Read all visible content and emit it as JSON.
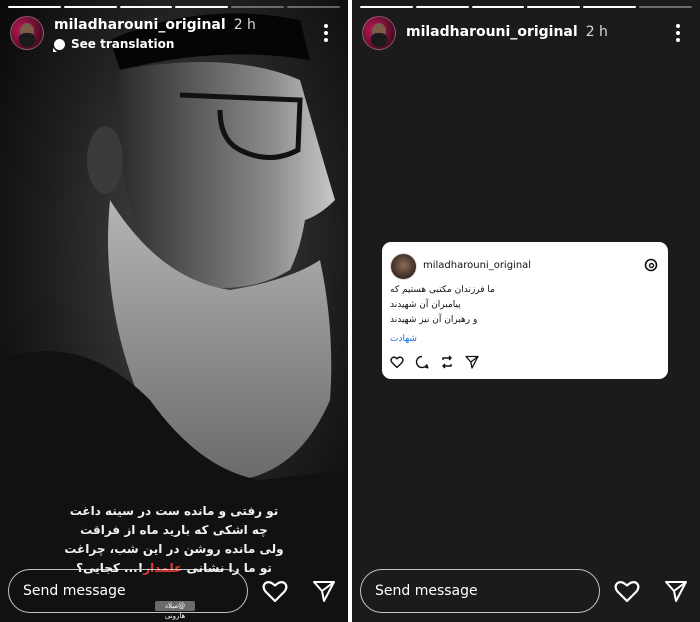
{
  "left_story": {
    "username": "miladharouni_original",
    "time": "2 h",
    "translation_label": "See translation",
    "poem_lines": [
      "تو رفتی و مانده ست در سینه داغت",
      "چه اشکی که بارید ماه از فراقت",
      "ولی مانده روشن در این شب، چراغت"
    ],
    "poem_last_before": "تو ما را نشانی",
    "poem_highlight": "علمدار",
    "poem_last_after": "!... کجایی؟",
    "watermark": "@میلاد هارونی",
    "send_placeholder": "Send message"
  },
  "right_story": {
    "username": "miladharouni_original",
    "time": "2 h",
    "card": {
      "username": "miladharouni_original",
      "lines": [
        "ما فرزندان مکتبی هستیم که",
        "پیامبران آن شهیدند",
        "و رهبران آن نیز شهیدند"
      ],
      "hashtag": "شهادت"
    },
    "send_placeholder": "Send message"
  },
  "colors": {
    "highlight_red": "#e53935",
    "link_blue": "#1a73e8"
  },
  "icons": [
    "more-icon",
    "heart-icon",
    "send-icon",
    "translate-icon",
    "threads-icon",
    "comment-icon",
    "repost-icon"
  ]
}
